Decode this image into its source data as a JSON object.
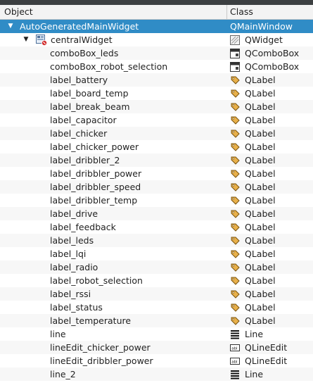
{
  "header": {
    "object_label": "Object",
    "class_label": "Class"
  },
  "rows": [
    {
      "name": "AutoGeneratedMainWidget",
      "cls": "QMainWindow",
      "icon": "none",
      "level": 0,
      "expanded": true
    },
    {
      "name": "centralWidget",
      "cls": "QWidget",
      "icon": "widget-icon",
      "level": 1,
      "expanded": true
    },
    {
      "name": "comboBox_leds",
      "cls": "QComboBox",
      "icon": "combobox-icon",
      "level": 2
    },
    {
      "name": "comboBox_robot_selection",
      "cls": "QComboBox",
      "icon": "combobox-icon",
      "level": 2
    },
    {
      "name": "label_battery",
      "cls": "QLabel",
      "icon": "label-icon",
      "level": 2
    },
    {
      "name": "label_board_temp",
      "cls": "QLabel",
      "icon": "label-icon",
      "level": 2
    },
    {
      "name": "label_break_beam",
      "cls": "QLabel",
      "icon": "label-icon",
      "level": 2
    },
    {
      "name": "label_capacitor",
      "cls": "QLabel",
      "icon": "label-icon",
      "level": 2
    },
    {
      "name": "label_chicker",
      "cls": "QLabel",
      "icon": "label-icon",
      "level": 2
    },
    {
      "name": "label_chicker_power",
      "cls": "QLabel",
      "icon": "label-icon",
      "level": 2
    },
    {
      "name": "label_dribbler_2",
      "cls": "QLabel",
      "icon": "label-icon",
      "level": 2
    },
    {
      "name": "label_dribbler_power",
      "cls": "QLabel",
      "icon": "label-icon",
      "level": 2
    },
    {
      "name": "label_dribbler_speed",
      "cls": "QLabel",
      "icon": "label-icon",
      "level": 2
    },
    {
      "name": "label_dribbler_temp",
      "cls": "QLabel",
      "icon": "label-icon",
      "level": 2
    },
    {
      "name": "label_drive",
      "cls": "QLabel",
      "icon": "label-icon",
      "level": 2
    },
    {
      "name": "label_feedback",
      "cls": "QLabel",
      "icon": "label-icon",
      "level": 2
    },
    {
      "name": "label_leds",
      "cls": "QLabel",
      "icon": "label-icon",
      "level": 2
    },
    {
      "name": "label_lqi",
      "cls": "QLabel",
      "icon": "label-icon",
      "level": 2
    },
    {
      "name": "label_radio",
      "cls": "QLabel",
      "icon": "label-icon",
      "level": 2
    },
    {
      "name": "label_robot_selection",
      "cls": "QLabel",
      "icon": "label-icon",
      "level": 2
    },
    {
      "name": "label_rssi",
      "cls": "QLabel",
      "icon": "label-icon",
      "level": 2
    },
    {
      "name": "label_status",
      "cls": "QLabel",
      "icon": "label-icon",
      "level": 2
    },
    {
      "name": "label_temperature",
      "cls": "QLabel",
      "icon": "label-icon",
      "level": 2
    },
    {
      "name": "line",
      "cls": "Line",
      "icon": "line-icon",
      "level": 2
    },
    {
      "name": "lineEdit_chicker_power",
      "cls": "QLineEdit",
      "icon": "lineedit-icon",
      "level": 2
    },
    {
      "name": "lineEdit_dribbler_power",
      "cls": "QLineEdit",
      "icon": "lineedit-icon",
      "level": 2
    },
    {
      "name": "line_2",
      "cls": "Line",
      "icon": "line-icon",
      "level": 2
    }
  ],
  "colors": {
    "selection": "#308cc6",
    "alternate": "#f7f7f7"
  }
}
